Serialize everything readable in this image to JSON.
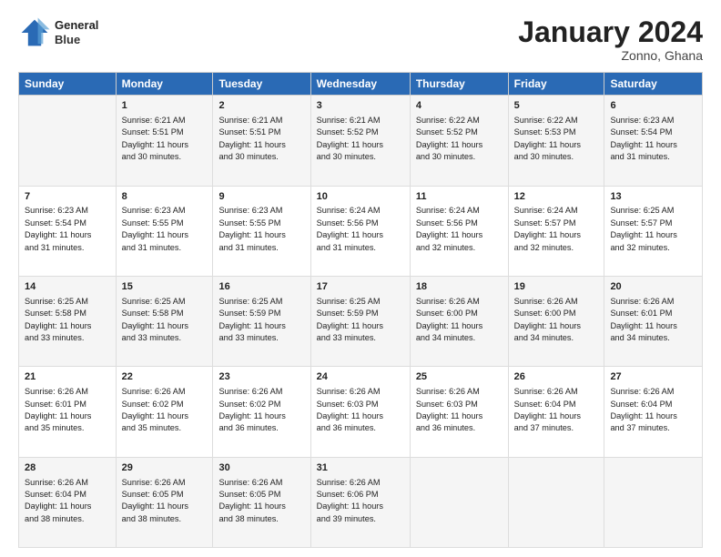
{
  "header": {
    "title": "January 2024",
    "subtitle": "Zonno, Ghana",
    "logo_line1": "General",
    "logo_line2": "Blue"
  },
  "columns": [
    "Sunday",
    "Monday",
    "Tuesday",
    "Wednesday",
    "Thursday",
    "Friday",
    "Saturday"
  ],
  "weeks": [
    [
      {
        "day": "",
        "lines": []
      },
      {
        "day": "1",
        "lines": [
          "Sunrise: 6:21 AM",
          "Sunset: 5:51 PM",
          "Daylight: 11 hours",
          "and 30 minutes."
        ]
      },
      {
        "day": "2",
        "lines": [
          "Sunrise: 6:21 AM",
          "Sunset: 5:51 PM",
          "Daylight: 11 hours",
          "and 30 minutes."
        ]
      },
      {
        "day": "3",
        "lines": [
          "Sunrise: 6:21 AM",
          "Sunset: 5:52 PM",
          "Daylight: 11 hours",
          "and 30 minutes."
        ]
      },
      {
        "day": "4",
        "lines": [
          "Sunrise: 6:22 AM",
          "Sunset: 5:52 PM",
          "Daylight: 11 hours",
          "and 30 minutes."
        ]
      },
      {
        "day": "5",
        "lines": [
          "Sunrise: 6:22 AM",
          "Sunset: 5:53 PM",
          "Daylight: 11 hours",
          "and 30 minutes."
        ]
      },
      {
        "day": "6",
        "lines": [
          "Sunrise: 6:23 AM",
          "Sunset: 5:54 PM",
          "Daylight: 11 hours",
          "and 31 minutes."
        ]
      }
    ],
    [
      {
        "day": "7",
        "lines": [
          "Sunrise: 6:23 AM",
          "Sunset: 5:54 PM",
          "Daylight: 11 hours",
          "and 31 minutes."
        ]
      },
      {
        "day": "8",
        "lines": [
          "Sunrise: 6:23 AM",
          "Sunset: 5:55 PM",
          "Daylight: 11 hours",
          "and 31 minutes."
        ]
      },
      {
        "day": "9",
        "lines": [
          "Sunrise: 6:23 AM",
          "Sunset: 5:55 PM",
          "Daylight: 11 hours",
          "and 31 minutes."
        ]
      },
      {
        "day": "10",
        "lines": [
          "Sunrise: 6:24 AM",
          "Sunset: 5:56 PM",
          "Daylight: 11 hours",
          "and 31 minutes."
        ]
      },
      {
        "day": "11",
        "lines": [
          "Sunrise: 6:24 AM",
          "Sunset: 5:56 PM",
          "Daylight: 11 hours",
          "and 32 minutes."
        ]
      },
      {
        "day": "12",
        "lines": [
          "Sunrise: 6:24 AM",
          "Sunset: 5:57 PM",
          "Daylight: 11 hours",
          "and 32 minutes."
        ]
      },
      {
        "day": "13",
        "lines": [
          "Sunrise: 6:25 AM",
          "Sunset: 5:57 PM",
          "Daylight: 11 hours",
          "and 32 minutes."
        ]
      }
    ],
    [
      {
        "day": "14",
        "lines": [
          "Sunrise: 6:25 AM",
          "Sunset: 5:58 PM",
          "Daylight: 11 hours",
          "and 33 minutes."
        ]
      },
      {
        "day": "15",
        "lines": [
          "Sunrise: 6:25 AM",
          "Sunset: 5:58 PM",
          "Daylight: 11 hours",
          "and 33 minutes."
        ]
      },
      {
        "day": "16",
        "lines": [
          "Sunrise: 6:25 AM",
          "Sunset: 5:59 PM",
          "Daylight: 11 hours",
          "and 33 minutes."
        ]
      },
      {
        "day": "17",
        "lines": [
          "Sunrise: 6:25 AM",
          "Sunset: 5:59 PM",
          "Daylight: 11 hours",
          "and 33 minutes."
        ]
      },
      {
        "day": "18",
        "lines": [
          "Sunrise: 6:26 AM",
          "Sunset: 6:00 PM",
          "Daylight: 11 hours",
          "and 34 minutes."
        ]
      },
      {
        "day": "19",
        "lines": [
          "Sunrise: 6:26 AM",
          "Sunset: 6:00 PM",
          "Daylight: 11 hours",
          "and 34 minutes."
        ]
      },
      {
        "day": "20",
        "lines": [
          "Sunrise: 6:26 AM",
          "Sunset: 6:01 PM",
          "Daylight: 11 hours",
          "and 34 minutes."
        ]
      }
    ],
    [
      {
        "day": "21",
        "lines": [
          "Sunrise: 6:26 AM",
          "Sunset: 6:01 PM",
          "Daylight: 11 hours",
          "and 35 minutes."
        ]
      },
      {
        "day": "22",
        "lines": [
          "Sunrise: 6:26 AM",
          "Sunset: 6:02 PM",
          "Daylight: 11 hours",
          "and 35 minutes."
        ]
      },
      {
        "day": "23",
        "lines": [
          "Sunrise: 6:26 AM",
          "Sunset: 6:02 PM",
          "Daylight: 11 hours",
          "and 36 minutes."
        ]
      },
      {
        "day": "24",
        "lines": [
          "Sunrise: 6:26 AM",
          "Sunset: 6:03 PM",
          "Daylight: 11 hours",
          "and 36 minutes."
        ]
      },
      {
        "day": "25",
        "lines": [
          "Sunrise: 6:26 AM",
          "Sunset: 6:03 PM",
          "Daylight: 11 hours",
          "and 36 minutes."
        ]
      },
      {
        "day": "26",
        "lines": [
          "Sunrise: 6:26 AM",
          "Sunset: 6:04 PM",
          "Daylight: 11 hours",
          "and 37 minutes."
        ]
      },
      {
        "day": "27",
        "lines": [
          "Sunrise: 6:26 AM",
          "Sunset: 6:04 PM",
          "Daylight: 11 hours",
          "and 37 minutes."
        ]
      }
    ],
    [
      {
        "day": "28",
        "lines": [
          "Sunrise: 6:26 AM",
          "Sunset: 6:04 PM",
          "Daylight: 11 hours",
          "and 38 minutes."
        ]
      },
      {
        "day": "29",
        "lines": [
          "Sunrise: 6:26 AM",
          "Sunset: 6:05 PM",
          "Daylight: 11 hours",
          "and 38 minutes."
        ]
      },
      {
        "day": "30",
        "lines": [
          "Sunrise: 6:26 AM",
          "Sunset: 6:05 PM",
          "Daylight: 11 hours",
          "and 38 minutes."
        ]
      },
      {
        "day": "31",
        "lines": [
          "Sunrise: 6:26 AM",
          "Sunset: 6:06 PM",
          "Daylight: 11 hours",
          "and 39 minutes."
        ]
      },
      {
        "day": "",
        "lines": []
      },
      {
        "day": "",
        "lines": []
      },
      {
        "day": "",
        "lines": []
      }
    ]
  ]
}
